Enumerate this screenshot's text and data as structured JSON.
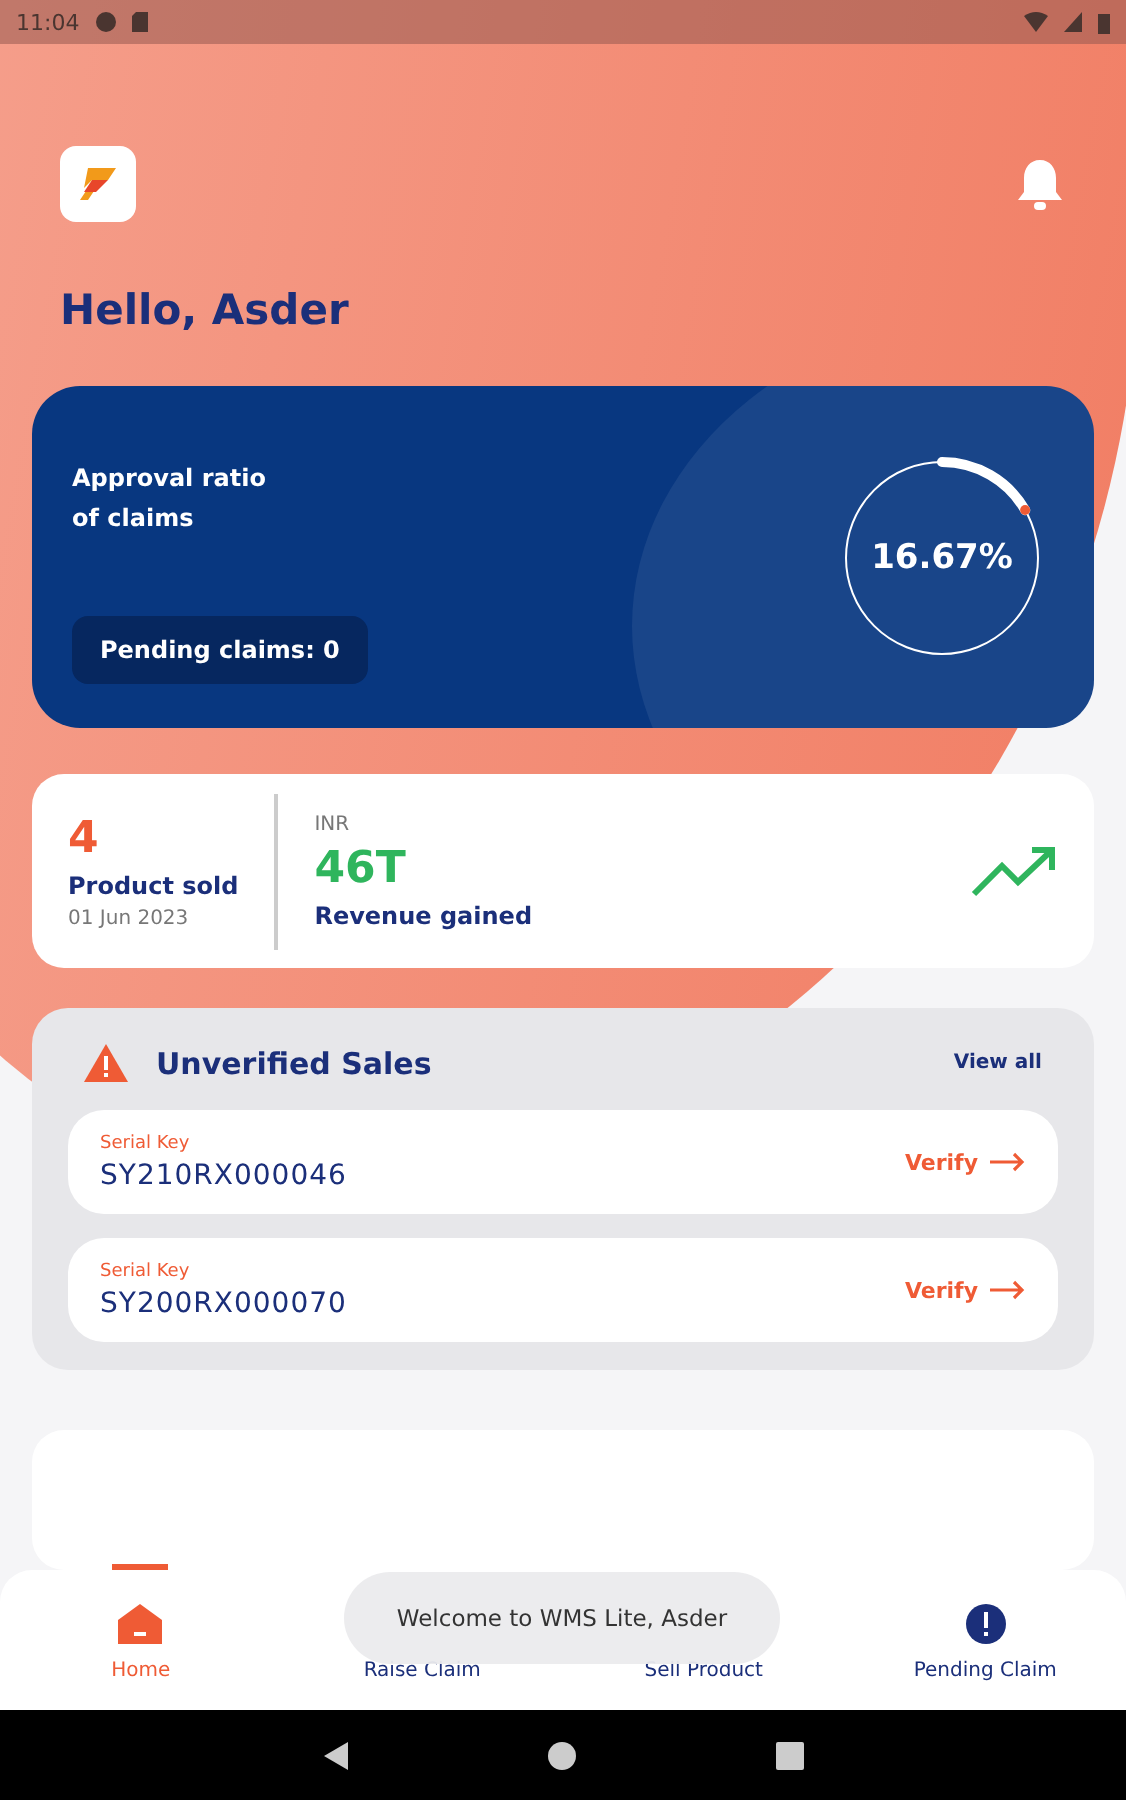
{
  "status_bar": {
    "time": "11:04"
  },
  "greeting": "Hello, Asder",
  "approval": {
    "title": "Approval ratio\nof claims",
    "pending": "Pending claims: 0",
    "percent": "16.67%",
    "level": 0.1667
  },
  "stats": {
    "count": "4",
    "count_label": "Product sold",
    "date": "01 Jun 2023",
    "currency": "INR",
    "revenue": "46T",
    "revenue_label": "Revenue gained"
  },
  "unverified": {
    "title": "Unverified Sales",
    "view_all": "View all",
    "items": [
      {
        "label": "Serial Key",
        "serial": "SY210RX000046",
        "action": "Verify"
      },
      {
        "label": "Serial Key",
        "serial": "SY200RX000070",
        "action": "Verify"
      }
    ]
  },
  "nav": [
    {
      "label": "Home",
      "kind": "home",
      "selected": true
    },
    {
      "label": "Raise Claim",
      "kind": "hidden",
      "selected": false
    },
    {
      "label": "Sell Product",
      "kind": "hidden",
      "selected": false
    },
    {
      "label": "Pending Claim",
      "kind": "alert",
      "selected": false
    }
  ],
  "toast": "Welcome to WMS Lite, Asder"
}
